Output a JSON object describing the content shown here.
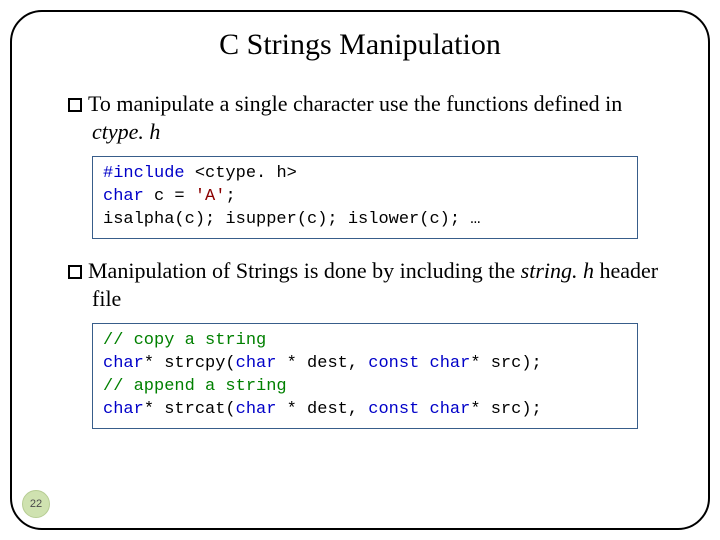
{
  "title": "C Strings Manipulation",
  "bullets": {
    "b1_a": "To manipulate a single character use the functions defined in ",
    "b1_b": "ctype. h",
    "b2_a": "Manipulation of Strings is done by including the ",
    "b2_b": "string. h",
    "b2_c": " header file"
  },
  "code1": {
    "l1a": "#include",
    "l1b": " <ctype. h>",
    "l2a": "char",
    "l2b": " c = ",
    "l2c": "'A'",
    "l2d": ";",
    "l3": "isalpha(c); isupper(c); islower(c);   …"
  },
  "code2": {
    "l1": "// copy a string",
    "l2a": "char",
    "l2b": "* strcpy(",
    "l2c": "char",
    "l2d": " * dest, ",
    "l2e": "const char",
    "l2f": "* src);",
    "l3": "// append a string",
    "l4a": "char",
    "l4b": "* strcat(",
    "l4c": "char",
    "l4d": " * dest, ",
    "l4e": "const char",
    "l4f": "* src);"
  },
  "page_number": "22"
}
